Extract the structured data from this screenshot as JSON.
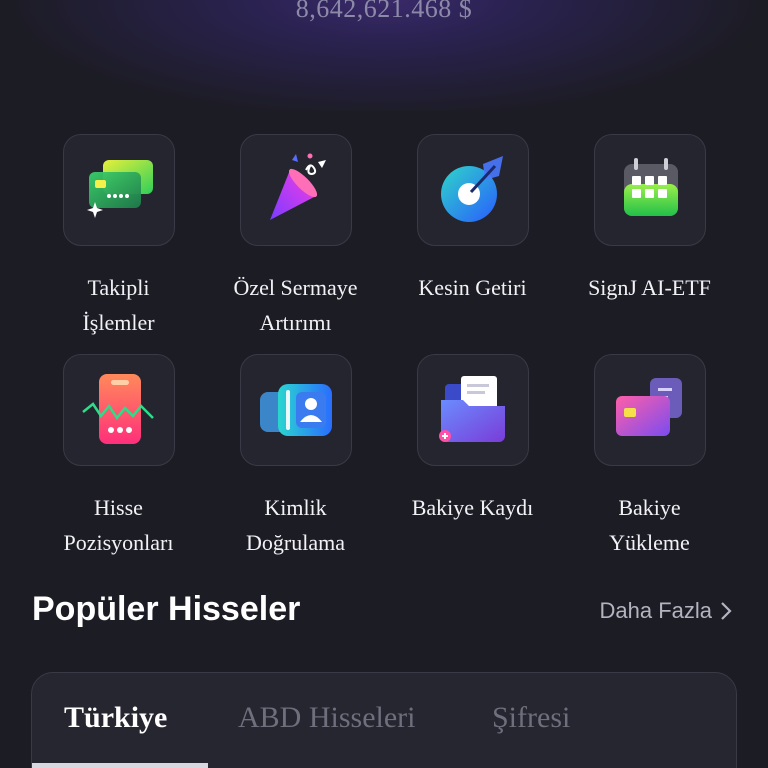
{
  "header": {
    "balance": "8,642,621.468 $"
  },
  "features": [
    {
      "label_line1": "Takipli",
      "label_line2": "İşlemler",
      "icon": "copy-trading-cards-icon"
    },
    {
      "label_line1": "Özel Sermaye",
      "label_line2": "Artırımı",
      "icon": "party-popper-icon"
    },
    {
      "label_line1": "Kesin Getiri",
      "label_line2": "",
      "icon": "target-ring-icon"
    },
    {
      "label_line1": "SignJ AI-ETF",
      "label_line2": "",
      "icon": "calendar-grid-icon"
    },
    {
      "label_line1": "Hisse",
      "label_line2": "Pozisyonları",
      "icon": "stock-phone-chart-icon"
    },
    {
      "label_line1": "Kimlik",
      "label_line2": "Doğrulama",
      "icon": "id-card-icon"
    },
    {
      "label_line1": "Bakiye Kaydı",
      "label_line2": "",
      "icon": "folder-records-icon"
    },
    {
      "label_line1": "Bakiye",
      "label_line2": "Yükleme",
      "icon": "wallet-card-icon"
    }
  ],
  "popular": {
    "title": "Popüler Hisseler",
    "more_label": "Daha Fazla"
  },
  "tabs": [
    {
      "label": "Türkiye",
      "active": true
    },
    {
      "label": "ABD Hisseleri",
      "active": false
    },
    {
      "label": "Şifresi",
      "active": false
    }
  ],
  "colors": {
    "background": "#1c1c24",
    "tile_background": "#25252f",
    "muted_text": "#8c8aa8"
  }
}
